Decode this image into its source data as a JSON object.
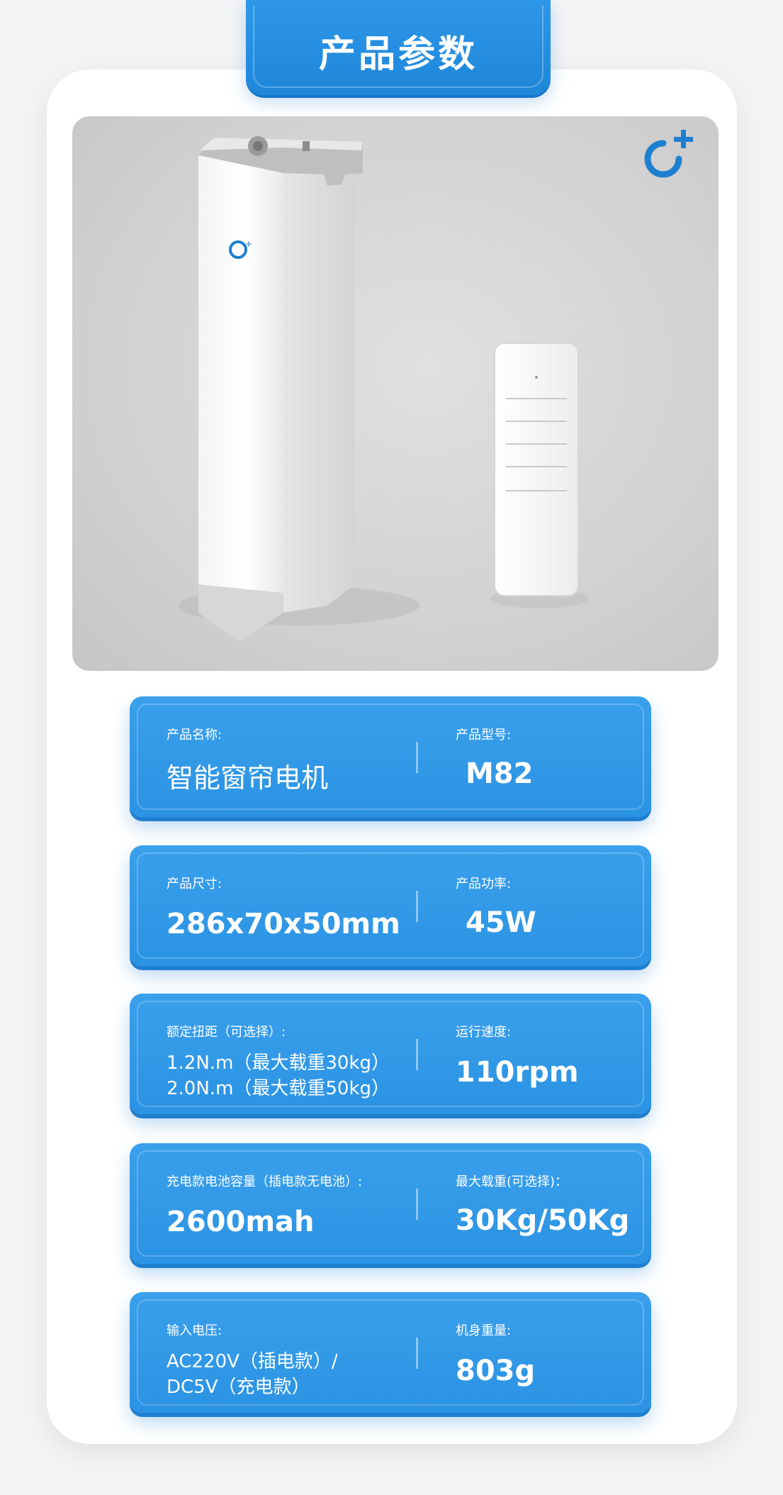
{
  "header": {
    "title": "产品参数"
  },
  "photo": {
    "logo_icon": "c-plus-logo-icon",
    "products": [
      "curtain-motor",
      "remote-control"
    ]
  },
  "colors": {
    "accent": "#2b93e3",
    "accent_dark": "#1f7fcf",
    "card_bg": "#ffffff",
    "page_bg": "#f3f4f6"
  },
  "specs": [
    {
      "left_label": "产品名称:",
      "left_value": "智能窗帘电机",
      "right_label": "产品型号:",
      "right_value": "M82"
    },
    {
      "left_label": "产品尺寸:",
      "left_value": "286x70x50mm",
      "right_label": "产品功率:",
      "right_value": "45W"
    },
    {
      "left_label": "额定扭距（可选择）:",
      "left_lines": [
        "1.2N.m（最大载重30kg）",
        "2.0N.m（最大载重50kg）"
      ],
      "right_label": "运行速度:",
      "right_value": "110rpm"
    },
    {
      "left_label": "充电款电池容量（插电款无电池）:",
      "left_value": "2600mah",
      "right_label": "最大载重(可选择)：",
      "right_value": "30Kg/50Kg"
    },
    {
      "left_label": "输入电压:",
      "left_lines": [
        "AC220V（插电款）/",
        "DC5V（充电款）"
      ],
      "right_label": "机身重量:",
      "right_value": "803g"
    }
  ]
}
